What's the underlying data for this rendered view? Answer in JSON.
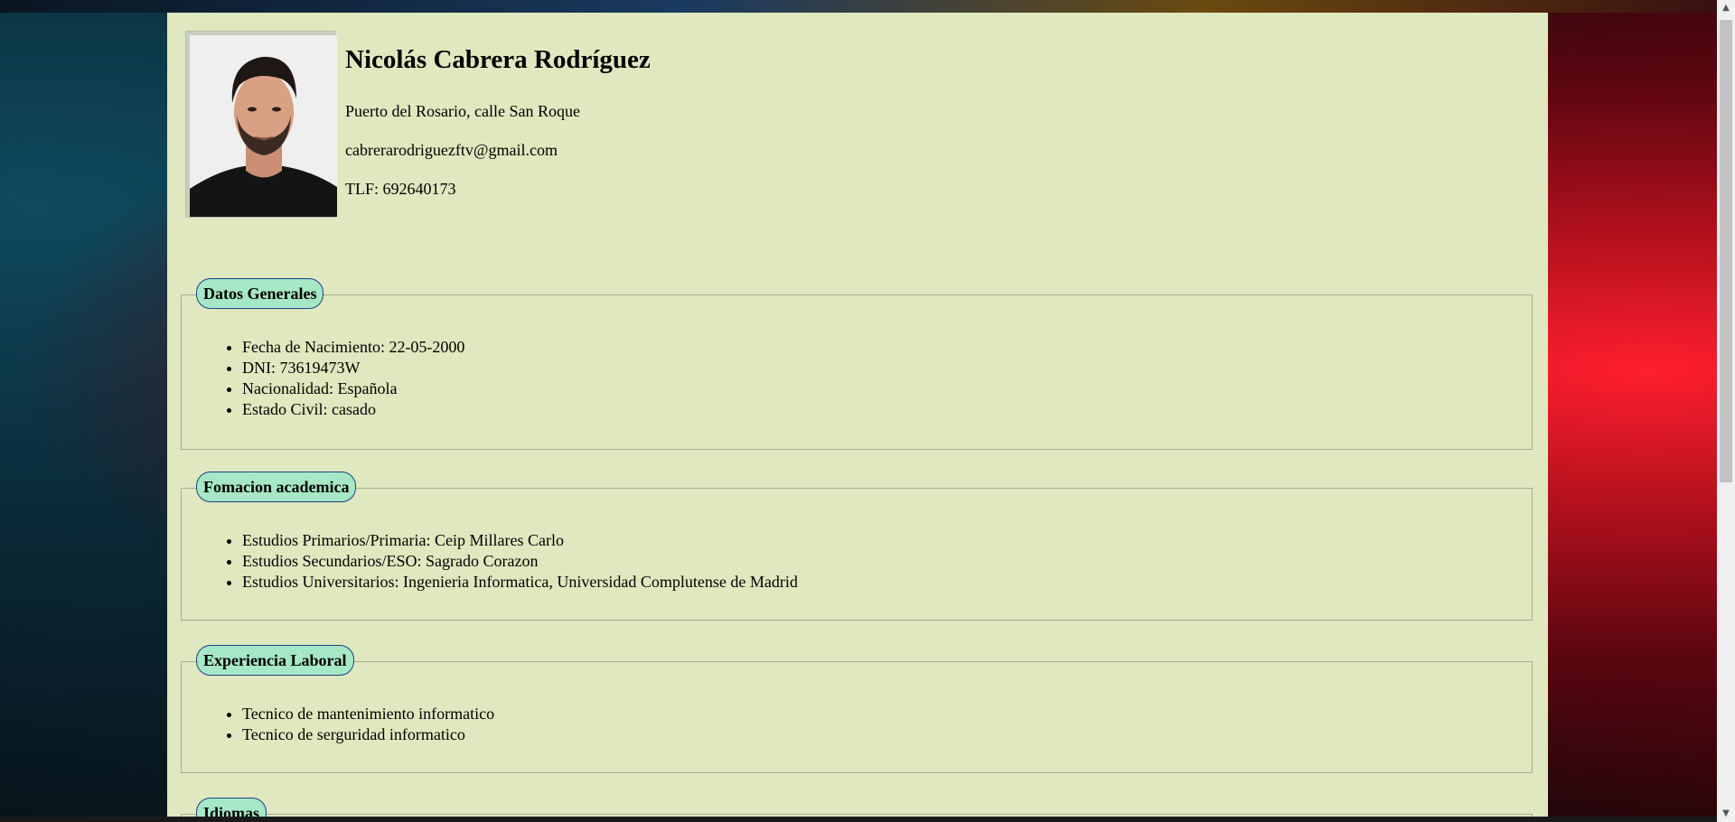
{
  "profile": {
    "name": "Nicolás Cabrera Rodríguez",
    "address": "Puerto del Rosario, calle San Roque",
    "email": "cabrerarodriguezftv@gmail.com",
    "phone": "TLF: 692640173"
  },
  "sections": [
    {
      "title": "Datos Generales",
      "items": [
        "Fecha de Nacimiento: 22-05-2000",
        "DNI: 73619473W",
        "Nacionalidad: Española",
        "Estado Civil: casado"
      ]
    },
    {
      "title": "Fomacion academica",
      "items": [
        "Estudios Primarios/Primaria: Ceip Millares Carlo",
        "Estudios Secundarios/ESO: Sagrado Corazon",
        "Estudios Universitarios: Ingenieria Informatica, Universidad Complutense de Madrid"
      ]
    },
    {
      "title": "Experiencia Laboral",
      "items": [
        "Tecnico de mantenimiento informatico",
        "Tecnico de serguridad informatico"
      ]
    },
    {
      "title": "Idiomas",
      "items": []
    }
  ],
  "colors": {
    "page_background": "#dfe8be",
    "legend_fill": "#a6e8c6",
    "legend_border": "#1f3f8a"
  },
  "icons": {
    "scroll_up": "chevron-up-icon",
    "scroll_down": "chevron-down-icon"
  }
}
